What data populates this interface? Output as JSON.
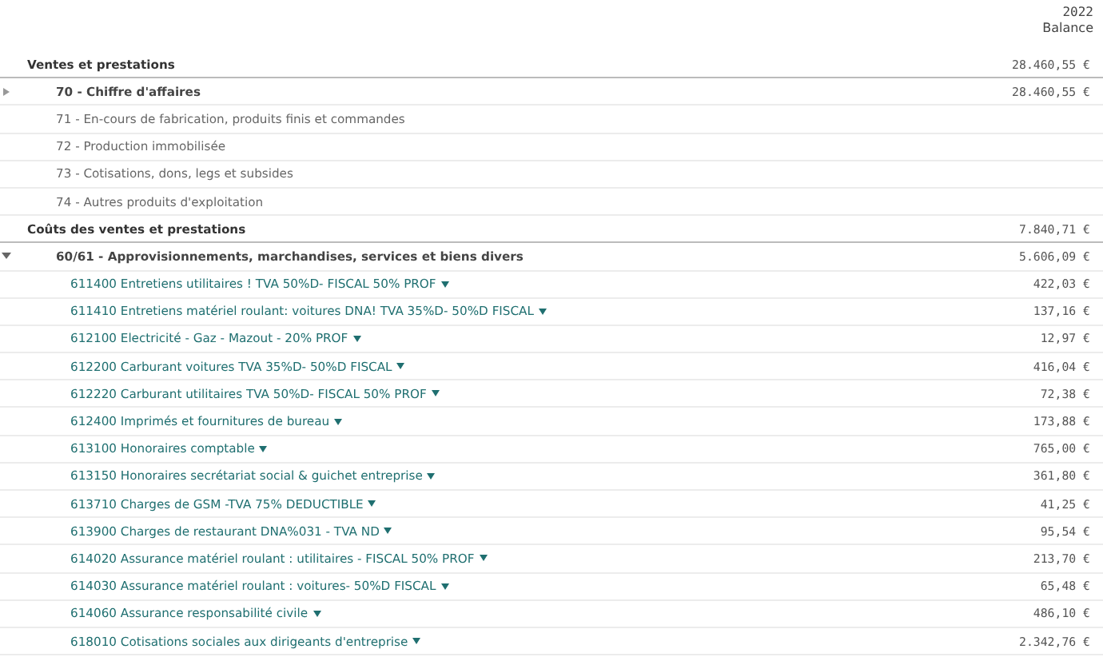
{
  "header": {
    "year": "2022",
    "column": "Balance"
  },
  "sections": [
    {
      "label": "Ventes et prestations",
      "balance": "28.460,55 €",
      "rows": [
        {
          "kind": "group",
          "label": "70 - Chiffre d'affaires",
          "balance": "28.460,55 €",
          "expanded": false
        },
        {
          "kind": "line",
          "label": "71 - En-cours de fabrication, produits finis et commandes"
        },
        {
          "kind": "line",
          "label": "72 - Production immobilisée"
        },
        {
          "kind": "line",
          "label": "73 - Cotisations, dons, legs et subsides"
        },
        {
          "kind": "line",
          "label": "74 - Autres produits d'exploitation"
        }
      ]
    },
    {
      "label": "Coûts des ventes et prestations",
      "balance": "7.840,71 €",
      "rows": [
        {
          "kind": "group",
          "label": "60/61 - Approvisionnements, marchandises, services et biens divers",
          "balance": "5.606,09 €",
          "expanded": true,
          "children": [
            {
              "label": "611400 Entretiens utilitaires ! TVA 50%D- FISCAL 50% PROF",
              "balance": "422,03 €"
            },
            {
              "label": "611410 Entretiens matériel roulant: voitures DNA! TVA 35%D- 50%D FISCAL",
              "balance": "137,16 €"
            },
            {
              "label": "612100 Electricité - Gaz - Mazout - 20% PROF",
              "balance": "12,97 €"
            },
            {
              "label": "612200 Carburant voitures TVA 35%D- 50%D FISCAL",
              "balance": "416,04 €"
            },
            {
              "label": "612220 Carburant utilitaires TVA 50%D- FISCAL 50% PROF",
              "balance": "72,38 €"
            },
            {
              "label": "612400 Imprimés et fournitures de bureau",
              "balance": "173,88 €"
            },
            {
              "label": "613100 Honoraires comptable",
              "balance": "765,00 €"
            },
            {
              "label": "613150 Honoraires secrétariat social & guichet entreprise",
              "balance": "361,80 €"
            },
            {
              "label": "613710 Charges de GSM -TVA 75% DEDUCTIBLE",
              "balance": "41,25 €"
            },
            {
              "label": "613900 Charges de restaurant DNA%031 - TVA ND",
              "balance": "95,54 €"
            },
            {
              "label": "614020 Assurance matériel roulant : utilitaires - FISCAL 50% PROF",
              "balance": "213,70 €"
            },
            {
              "label": "614030 Assurance matériel roulant : voitures- 50%D FISCAL",
              "balance": "65,48 €"
            },
            {
              "label": "614060 Assurance responsabilité civile",
              "balance": "486,10 €"
            },
            {
              "label": "618010 Cotisations sociales aux dirigeants d'entreprise",
              "balance": "2.342,76 €"
            }
          ]
        }
      ]
    }
  ]
}
